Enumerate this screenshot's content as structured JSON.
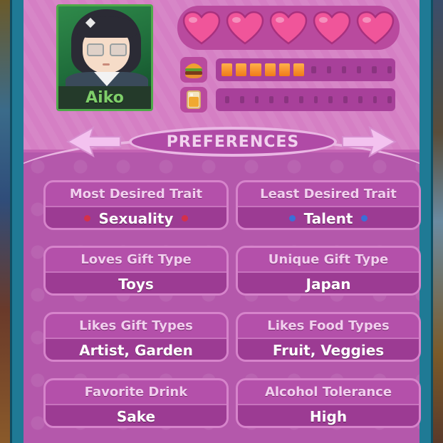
{
  "character": {
    "name": "Aiko"
  },
  "affection": {
    "hearts_filled": 5,
    "hearts_total": 5
  },
  "stats": {
    "hunger": {
      "icon": "burger-icon",
      "filled": 6,
      "total": 12
    },
    "thirst": {
      "icon": "drink-icon",
      "filled": 0,
      "total": 12
    }
  },
  "colors": {
    "heart": "#f0559a",
    "bar_fill": "#f59a2a",
    "name": "#7fcf6a",
    "sexuality_dot": "#d4304a",
    "talent_dot": "#3a6fd8"
  },
  "preferences": {
    "title": "PREFERENCES",
    "most_desired_trait": {
      "label": "Most Desired Trait",
      "value": "Sexuality"
    },
    "least_desired_trait": {
      "label": "Least Desired Trait",
      "value": "Talent"
    },
    "loves_gift_type": {
      "label": "Loves Gift Type",
      "value": "Toys"
    },
    "unique_gift_type": {
      "label": "Unique Gift Type",
      "value": "Japan"
    },
    "likes_gift_types": {
      "label": "Likes Gift Types",
      "value": "Artist, Garden"
    },
    "likes_food_types": {
      "label": "Likes Food Types",
      "value": "Fruit, Veggies"
    },
    "favorite_drink": {
      "label": "Favorite Drink",
      "value": "Sake"
    },
    "alcohol_tolerance": {
      "label": "Alcohol Tolerance",
      "value": "High"
    }
  }
}
